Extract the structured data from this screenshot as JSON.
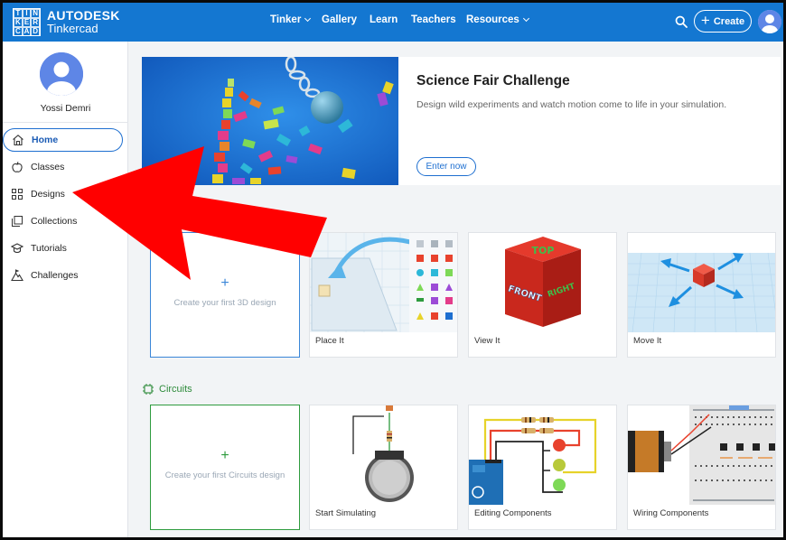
{
  "header": {
    "logo_letters": [
      "TIN",
      "KER",
      "CAD"
    ],
    "brand_name": "AUTODESK",
    "product_name": "Tinkercad",
    "nav": [
      {
        "label": "Tinker",
        "dropdown": true
      },
      {
        "label": "Gallery",
        "dropdown": false
      },
      {
        "label": "Learn",
        "dropdown": false
      },
      {
        "label": "Teachers",
        "dropdown": false
      },
      {
        "label": "Resources",
        "dropdown": true
      }
    ],
    "create_label": "Create",
    "accent_color": "#1477d1"
  },
  "sidebar": {
    "username": "Yossi Demri",
    "items": [
      {
        "label": "Home",
        "icon": "home-icon",
        "active": true
      },
      {
        "label": "Classes",
        "icon": "apple-icon",
        "active": false
      },
      {
        "label": "Designs",
        "icon": "grid-icon",
        "active": false
      },
      {
        "label": "Collections",
        "icon": "collections-icon",
        "active": false
      },
      {
        "label": "Tutorials",
        "icon": "graduation-cap-icon",
        "active": false
      },
      {
        "label": "Challenges",
        "icon": "mountain-icon",
        "active": false
      }
    ]
  },
  "hero": {
    "title": "Science Fair Challenge",
    "description": "Design wild experiments and watch motion come to life in your simulation.",
    "button_label": "Enter now"
  },
  "designs": {
    "create_first_label": "Create your first 3D design",
    "cards": [
      "Place It",
      "View It",
      "Move It"
    ]
  },
  "circuits": {
    "section_title": "Circuits",
    "create_first_label": "Create your first Circuits design",
    "cards": [
      "Start Simulating",
      "Editing Components",
      "Wiring Components"
    ]
  },
  "viewcube_labels": {
    "top": "TOP",
    "front": "FRONT",
    "right": "RIGHT"
  },
  "annotation_color": "#ff0000"
}
